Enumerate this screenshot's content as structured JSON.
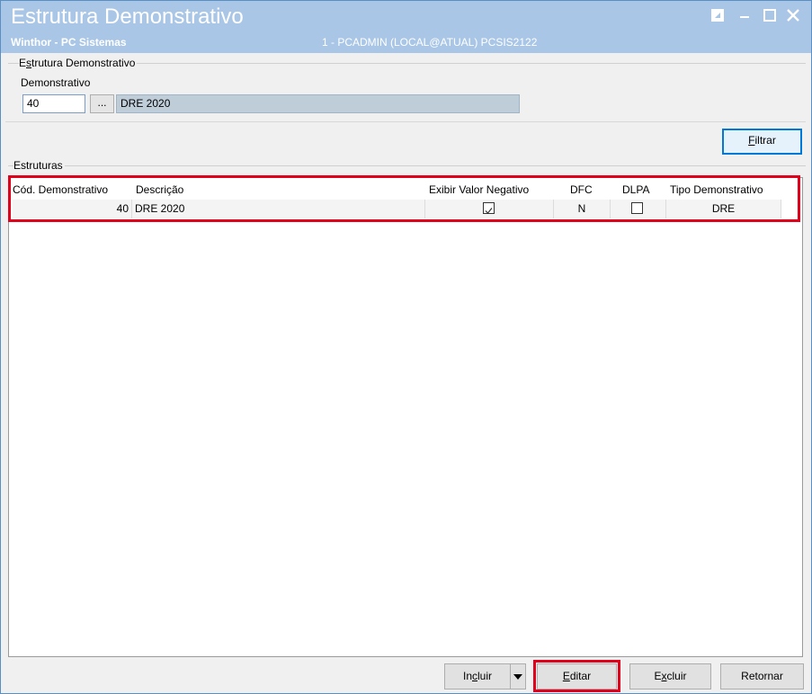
{
  "window": {
    "title": "Estrutura Demonstrativo",
    "subtitle": "Winthor - PC Sistemas",
    "session": "1 - PCADMIN (LOCAL@ATUAL)   PCSIS2122"
  },
  "filter_group": {
    "title_pre": "E",
    "title_ul": "s",
    "title_post": "trutura Demonstrativo",
    "demonstrativo_label": "Demonstrativo",
    "demonstrativo_code": "40",
    "lookup_label": "...",
    "demonstrativo_desc": "DRE 2020"
  },
  "filtrar": {
    "ul": "F",
    "rest": "iltrar"
  },
  "estruturas": {
    "title": "Estruturas",
    "columns": [
      "Cód. Demonstrativo",
      "Descrição",
      "Exibir Valor Negativo",
      "DFC",
      "DLPA",
      "Tipo Demonstrativo"
    ],
    "rows": [
      {
        "cod": "40",
        "descricao": "DRE 2020",
        "exibir_valor_negativo": true,
        "dfc": "N",
        "dlpa": false,
        "tipo": "DRE"
      }
    ]
  },
  "buttons": {
    "incluir": {
      "pre": "In",
      "ul": "c",
      "post": "luir"
    },
    "editar": {
      "ul": "E",
      "rest": "ditar"
    },
    "excluir": {
      "pre": "E",
      "ul": "x",
      "post": "cluir"
    },
    "retornar": "Retornar"
  },
  "colors": {
    "titlebar": "#a9c6e6",
    "highlight": "#e0001b",
    "lookup_desc_bg": "#bfcdd9"
  }
}
